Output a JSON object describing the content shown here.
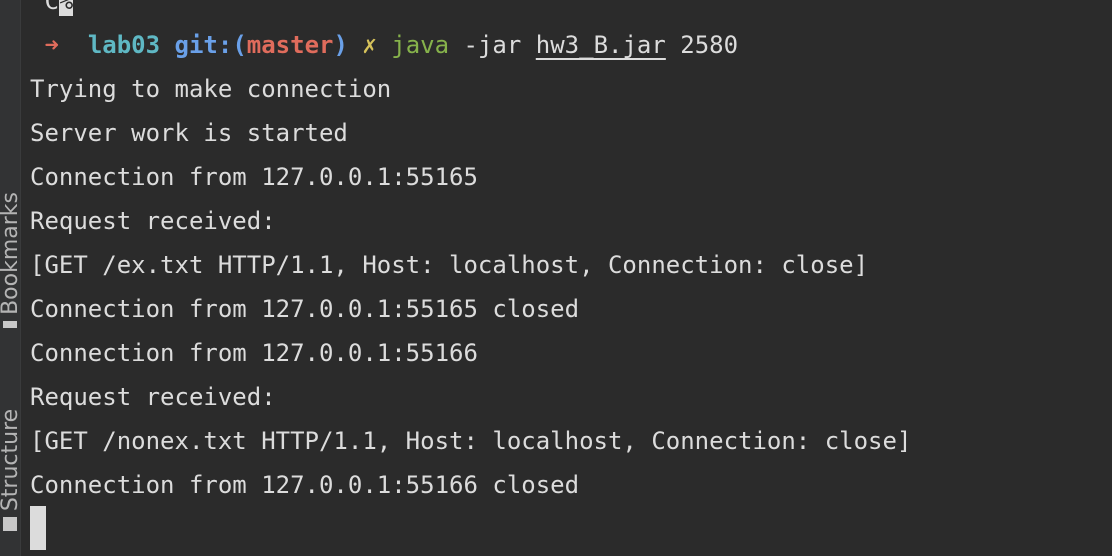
{
  "sidebar": {
    "bookmarks_label": "Bookmarks",
    "structure_label": "Structure"
  },
  "terminal": {
    "previous_line": "^C",
    "previous_line_prompt_char": "%",
    "prompt": {
      "arrow": "➜",
      "directory": "lab03",
      "git_label": "git:(",
      "branch": "master",
      "git_close": ")",
      "dirty_mark": "✗",
      "command": "java",
      "args": "-jar",
      "jar_file": "hw3_B.jar",
      "port": "2580"
    },
    "output_lines": [
      "Trying to make connection",
      "Server work is started",
      "Connection from 127.0.0.1:55165",
      "Request received:",
      "[GET /ex.txt HTTP/1.1, Host: localhost, Connection: close]",
      "Connection from 127.0.0.1:55165 closed",
      "Connection from 127.0.0.1:55166",
      "Request received:",
      "[GET /nonex.txt HTTP/1.1, Host: localhost, Connection: close]",
      "Connection from 127.0.0.1:55166 closed"
    ]
  },
  "colors": {
    "background": "#2b2b2b",
    "text": "#dcdcdc",
    "arrow": "#e06c5c",
    "directory": "#5fb8c4",
    "git": "#6aa0e8",
    "branch": "#e06c5c",
    "dirty_mark": "#d6c25b",
    "command": "#86b24b"
  },
  "icons": {
    "bookmarks_tab": "bookmark-icon",
    "structure_tab": "structure-icon"
  }
}
